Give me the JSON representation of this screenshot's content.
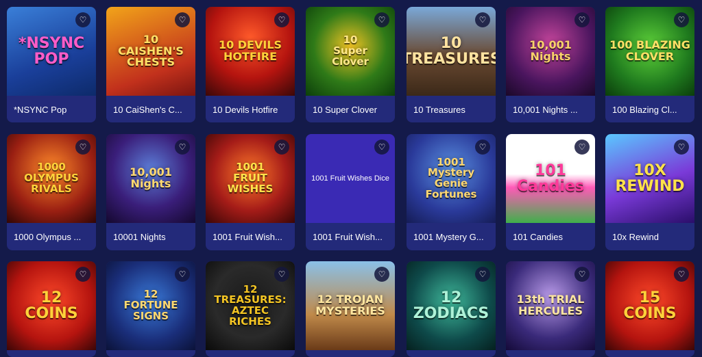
{
  "games": [
    {
      "title": "*NSYNC Pop",
      "art": "*NSYNC\nPOP",
      "bg": "linear-gradient(160deg,#3a7fd8,#1a3f9a 60%,#0d2a6a)",
      "fg": "#ff5cc8"
    },
    {
      "title": "10 CaiShen's C...",
      "art": "10 CAISHEN'S\nCHESTS",
      "bg": "linear-gradient(160deg,#f2a41a,#c2311c 70%,#7a1410)",
      "fg": "#ffe066"
    },
    {
      "title": "10 Devils Hotfire",
      "art": "10 DEVILS\nHOTFIRE",
      "bg": "radial-gradient(circle at 50% 35%,#ff5a2a,#b5140f 55%,#3a0808)",
      "fg": "#ffd23a"
    },
    {
      "title": "10 Super Clover",
      "art": "10\nSuper\nClover",
      "bg": "radial-gradient(circle at 50% 45%,#f3c423,#2f7a18 55%,#0c3f0a)",
      "fg": "#ffe78a"
    },
    {
      "title": "10 Treasures",
      "art": "10 TREASURES",
      "bg": "linear-gradient(180deg,#7aa8d8,#6a4a32 55%,#3b2818)",
      "fg": "#ffe3a0"
    },
    {
      "title": "10,001 Nights ...",
      "art": "10,001\nNights",
      "bg": "radial-gradient(circle at 50% 40%,#c2449a,#4a155e 60%,#1a0828)",
      "fg": "#f8d26a"
    },
    {
      "title": "100 Blazing Cl...",
      "art": "100 BLAZING\nCLOVER",
      "bg": "radial-gradient(circle at 50% 45%,#5fd23a,#1f7a1e 60%,#0b3d0b)",
      "fg": "#ffe066"
    },
    {
      "title": "1000 Olympus ...",
      "art": "1000\nOLYMPUS\nRIVALS",
      "bg": "radial-gradient(circle at 50% 40%,#ff8a2a,#9a1f12 60%,#2f0605)",
      "fg": "#ffd23a"
    },
    {
      "title": "10001 Nights",
      "art": "10,001\nNights",
      "bg": "radial-gradient(circle at 50% 40%,#5c7ed8,#3a1e7a 55%,#14082e)",
      "fg": "#ffd870"
    },
    {
      "title": "1001 Fruit Wish...",
      "art": "1001\nFRUIT\nWISHES",
      "bg": "radial-gradient(circle at 50% 45%,#ff7a2a,#a51c18 55%,#3a0606)",
      "fg": "#ffe24a"
    },
    {
      "title": "1001 Fruit Wish...",
      "art": "1001 Fruit Wishes Dice",
      "bg": "#3a2ab4",
      "fg": "#ffffff",
      "plain": true
    },
    {
      "title": "1001 Mystery G...",
      "art": "1001\nMystery Genie\nFortunes",
      "bg": "radial-gradient(circle at 50% 40%,#5a90e0,#2a3a9a 60%,#151c55)",
      "fg": "#ffd870"
    },
    {
      "title": "101 Candies",
      "art": "101\nCandies",
      "bg": "linear-gradient(180deg,#ffffff 0%,#ffffff 45%,#ff5ab8 60%,#3fb04a)",
      "fg": "#ff3a9a"
    },
    {
      "title": "10x Rewind",
      "art": "10X\nREWIND",
      "bg": "linear-gradient(160deg,#5ac8ff,#7a3ad8 55%,#2a0e6a)",
      "fg": "#ffe24a"
    },
    {
      "title": "",
      "art": "12\nCOINS",
      "bg": "radial-gradient(circle at 50% 45%,#ff4a2a,#b5140f 60%,#3a0606)",
      "fg": "#ffd23a"
    },
    {
      "title": "",
      "art": "12\nFORTUNE\nSIGNS",
      "bg": "radial-gradient(circle at 50% 45%,#3a7ad8,#1a2e7a 60%,#0b1238)",
      "fg": "#ffd870"
    },
    {
      "title": "",
      "art": "12\nTREASURES:\nAZTEC RICHES",
      "bg": "radial-gradient(circle at 50% 45%,#1a1a1a,#2a2a2a 55%,#0a0a0a)",
      "fg": "#f3c423"
    },
    {
      "title": "",
      "art": "12 TROJAN\nMYSTERIES",
      "bg": "linear-gradient(180deg,#8ac0e8,#c08a4a 60%,#6a3a18)",
      "fg": "#ffe6a0"
    },
    {
      "title": "",
      "art": "12 ZODIACS",
      "bg": "radial-gradient(circle at 50% 45%,#3fb89a,#0e4a4a 60%,#05201f)",
      "fg": "#aef2d8"
    },
    {
      "title": "",
      "art": "13th TRIAL\nHERCULES",
      "bg": "radial-gradient(circle at 50% 40%,#b89ae8,#3a2a7a 60%,#140a38)",
      "fg": "#ffe6a0"
    },
    {
      "title": "",
      "art": "15\nCOINS",
      "bg": "radial-gradient(circle at 50% 45%,#ff4a2a,#b5140f 60%,#3a0606)",
      "fg": "#ffd23a"
    }
  ]
}
